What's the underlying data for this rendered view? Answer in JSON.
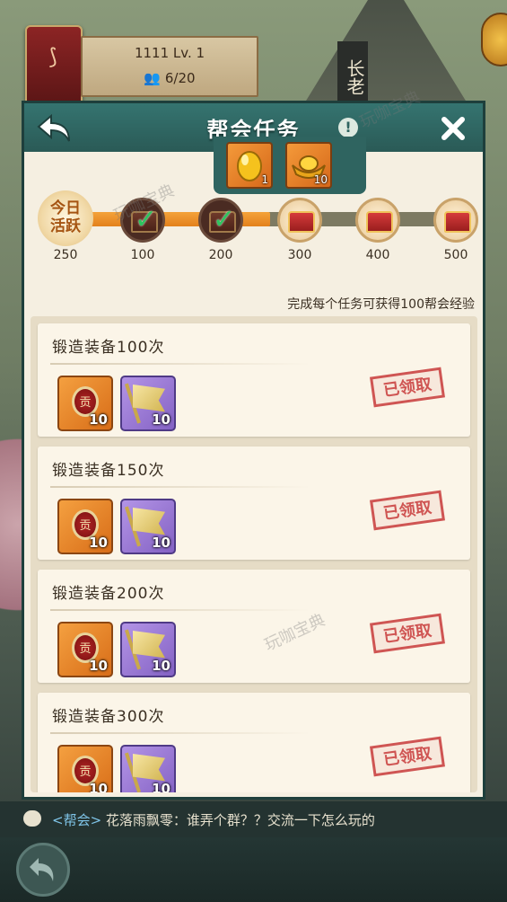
{
  "player": {
    "id_level": "1111  Lv. 1",
    "members": "6/20"
  },
  "sign": "长老",
  "panel": {
    "title": "帮会任务"
  },
  "top_rewards": [
    {
      "icon": "gold-egg-icon",
      "count": "1"
    },
    {
      "icon": "gold-ingot-icon",
      "count": "10"
    }
  ],
  "activity": {
    "badge_line1": "今日",
    "badge_line2": "活跃",
    "current": "250",
    "progress_fraction": 0.5,
    "milestones": [
      {
        "label": "100",
        "claimed": true
      },
      {
        "label": "200",
        "claimed": true
      },
      {
        "label": "300",
        "claimed": false
      },
      {
        "label": "400",
        "claimed": false
      },
      {
        "label": "500",
        "claimed": false
      }
    ]
  },
  "exp_note": "完成每个任务可获得100帮会经验",
  "tasks": [
    {
      "title": "锻造装备100次",
      "rewards": [
        {
          "icon": "guild-coin-icon",
          "glyph": "贡",
          "qty": "10"
        },
        {
          "icon": "banner-flag-icon",
          "qty": "10"
        }
      ],
      "status": "已领取"
    },
    {
      "title": "锻造装备150次",
      "rewards": [
        {
          "icon": "guild-coin-icon",
          "glyph": "贡",
          "qty": "10"
        },
        {
          "icon": "banner-flag-icon",
          "qty": "10"
        }
      ],
      "status": "已领取"
    },
    {
      "title": "锻造装备200次",
      "rewards": [
        {
          "icon": "guild-coin-icon",
          "glyph": "贡",
          "qty": "10"
        },
        {
          "icon": "banner-flag-icon",
          "qty": "10"
        }
      ],
      "status": "已领取"
    },
    {
      "title": "锻造装备300次",
      "rewards": [
        {
          "icon": "guild-coin-icon",
          "glyph": "贡",
          "qty": "10"
        },
        {
          "icon": "banner-flag-icon",
          "qty": "10"
        }
      ],
      "status": "已领取"
    }
  ],
  "watermark": "玩咖宝典",
  "chat": {
    "channel": "<帮会>",
    "message": "花落雨飘零：谁弄个群？？交流一下怎么玩的"
  }
}
